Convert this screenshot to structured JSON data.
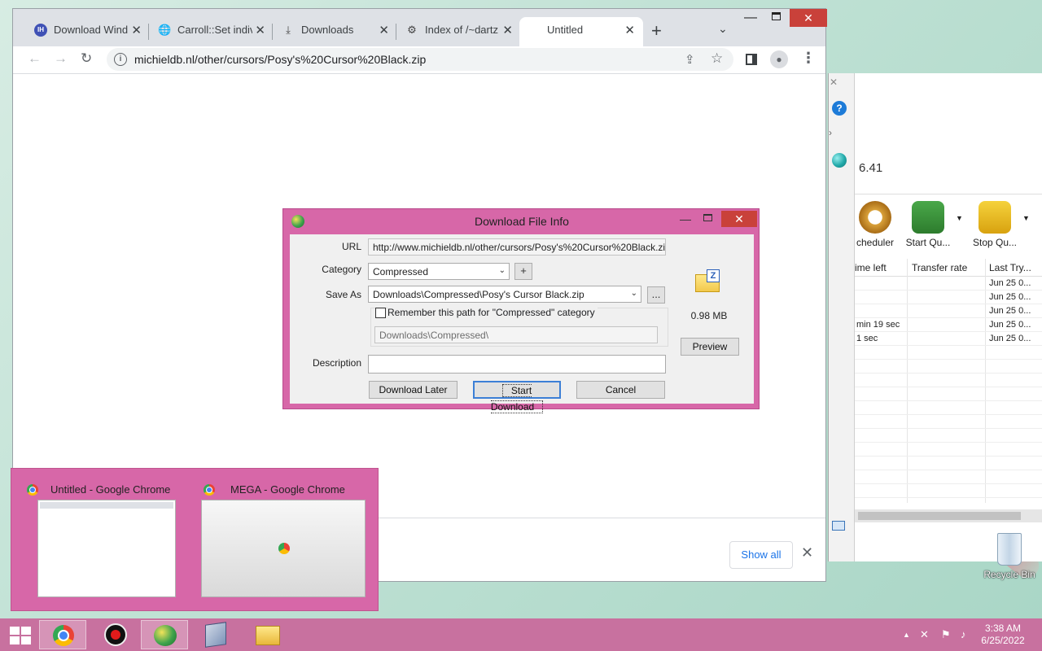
{
  "browser": {
    "tabs": [
      {
        "title": "Download Wind",
        "icon": "tab-favicon"
      },
      {
        "title": "Carroll::Set indiv",
        "icon": "globe-icon"
      },
      {
        "title": "Downloads",
        "icon": "download-icon"
      },
      {
        "title": "Index of /~dartz",
        "icon": "site-icon"
      },
      {
        "title": "Untitled",
        "icon": "none"
      }
    ],
    "url": "michieldb.nl/other/cursors/Posy's%20Cursor%20Black.zip",
    "show_all_label": "Show all"
  },
  "dialog": {
    "title": "Download File Info",
    "url_label": "URL",
    "url_value": "http://www.michieldb.nl/other/cursors/Posy's%20Cursor%20Black.zip",
    "category_label": "Category",
    "category_value": "Compressed",
    "save_as_label": "Save As",
    "save_as_value": "Downloads\\Compressed\\Posy's Cursor Black.zip",
    "remember_label": "Remember this path for \"Compressed\" category",
    "remember_checked": false,
    "remember_path": "Downloads\\Compressed\\",
    "description_label": "Description",
    "description_value": "",
    "add_category_label": "+",
    "browse_label": "...",
    "file_size": "0.98  MB",
    "preview_label": "Preview",
    "download_later_label": "Download Later",
    "start_download_label": "Start Download",
    "cancel_label": "Cancel"
  },
  "idm_window": {
    "version": "6.41",
    "toolbar": [
      {
        "label": "cheduler"
      },
      {
        "label": "Start Qu..."
      },
      {
        "label": "Stop Qu..."
      }
    ],
    "columns": [
      "ime left",
      "Transfer rate",
      "Last Try..."
    ],
    "rows": [
      {
        "time_left": "",
        "transfer_rate": "",
        "last_try": "Jun 25 0..."
      },
      {
        "time_left": "",
        "transfer_rate": "",
        "last_try": "Jun 25 0..."
      },
      {
        "time_left": "",
        "transfer_rate": "",
        "last_try": "Jun 25 0..."
      },
      {
        "time_left": "min 19 sec",
        "transfer_rate": "",
        "last_try": "Jun 25 0..."
      },
      {
        "time_left": "1 sec",
        "transfer_rate": "",
        "last_try": "Jun 25 0..."
      }
    ]
  },
  "thumbnails": [
    {
      "title": "Untitled - Google Chrome"
    },
    {
      "title": "MEGA - Google Chrome"
    }
  ],
  "desktop": {
    "recycle_bin_label": "Recycle Bin"
  },
  "taskbar": {
    "time": "3:38 AM",
    "date": "6/25/2022",
    "apps": [
      "chrome",
      "screen-recorder",
      "internet-download-manager",
      "virtualbox",
      "file-explorer"
    ]
  },
  "colors": {
    "accent": "#d767a8",
    "taskbar": "#c8719f",
    "close_red": "#c9413a",
    "link_blue": "#1a73e8"
  }
}
